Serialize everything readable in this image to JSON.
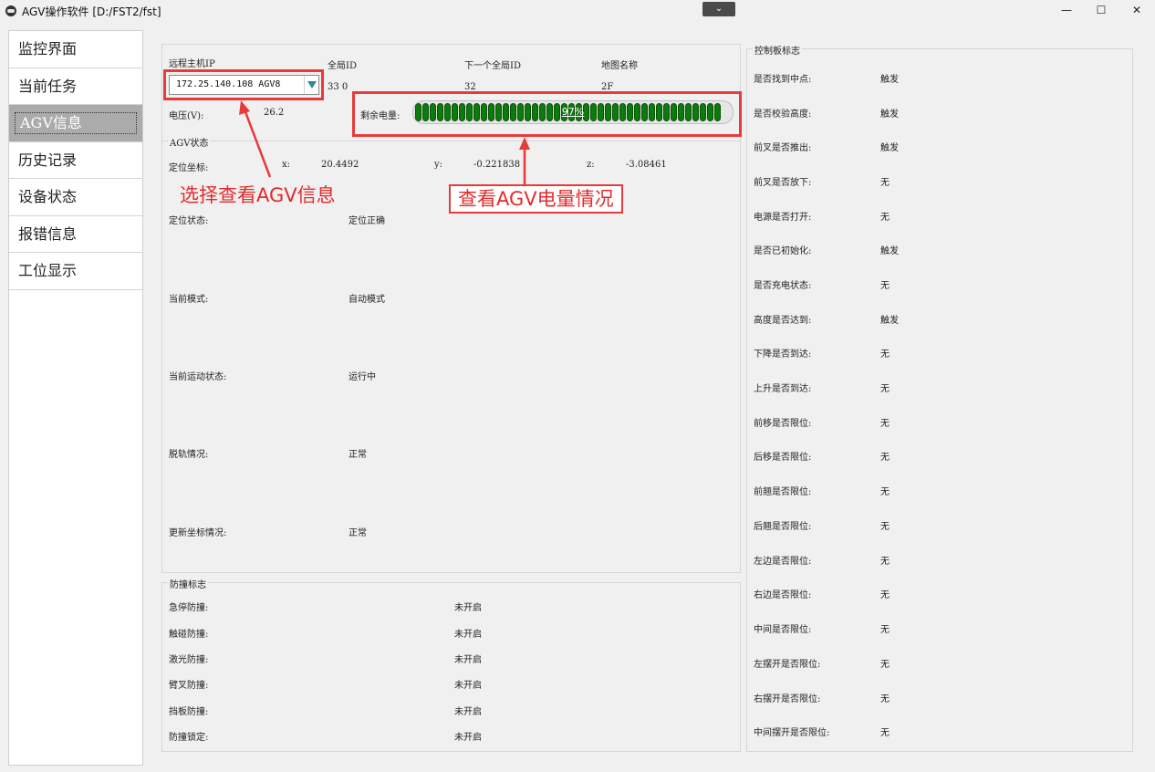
{
  "window": {
    "title": "AGV操作软件 [D:/FST2/fst]",
    "collapse_glyph": "⌄",
    "min_glyph": "—",
    "max_glyph": "☐",
    "close_glyph": "✕"
  },
  "sidebar": {
    "items": [
      {
        "label": "监控界面"
      },
      {
        "label": "当前任务"
      },
      {
        "label": "AGV信息"
      },
      {
        "label": "历史记录"
      },
      {
        "label": "设备状态"
      },
      {
        "label": "报错信息"
      },
      {
        "label": "工位显示"
      }
    ]
  },
  "header": {
    "remote_ip_label": "远程主机IP",
    "remote_ip_value": "172.25.140.108 AGV8",
    "global_id_label": "全局ID",
    "global_id_value": "33 0",
    "next_global_id_label": "下一个全局ID",
    "next_global_id_value": "32",
    "map_name_label": "地图名称",
    "map_name_value": "2F",
    "voltage_label": "电压(V):",
    "voltage_value": "26.2",
    "battery_label": "剩余电量:",
    "battery_text": "97%",
    "battery_level": 0.97
  },
  "agv_status": {
    "title": "AGV状态",
    "coord_label": "定位坐标:",
    "x_label": "x:",
    "x_value": "20.4492",
    "y_label": "y:",
    "y_value": "-0.221838",
    "z_label": "z:",
    "z_value": "-3.08461",
    "rows": [
      {
        "label": "定位状态:",
        "value": "定位正确"
      },
      {
        "label": "当前模式:",
        "value": "自动模式"
      },
      {
        "label": "当前运动状态:",
        "value": "运行中"
      },
      {
        "label": "脱轨情况:",
        "value": "正常"
      },
      {
        "label": "更新坐标情况:",
        "value": "正常"
      }
    ]
  },
  "collision": {
    "title": "防撞标志",
    "rows": [
      {
        "label": "急停防撞:",
        "value": "未开启"
      },
      {
        "label": "触碰防撞:",
        "value": "未开启"
      },
      {
        "label": "激光防撞:",
        "value": "未开启"
      },
      {
        "label": "臂叉防撞:",
        "value": "未开启"
      },
      {
        "label": "挡板防撞:",
        "value": "未开启"
      },
      {
        "label": "防撞锁定:",
        "value": "未开启"
      }
    ]
  },
  "control_flags": {
    "title": "控制板标志",
    "rows": [
      {
        "label": "是否找到中点:",
        "value": "触发"
      },
      {
        "label": "是否校验高度:",
        "value": "触发"
      },
      {
        "label": "前叉是否推出:",
        "value": "触发"
      },
      {
        "label": "前叉是否放下:",
        "value": "无"
      },
      {
        "label": "电源是否打开:",
        "value": "无"
      },
      {
        "label": "是否已初始化:",
        "value": "触发"
      },
      {
        "label": "是否充电状态:",
        "value": "无"
      },
      {
        "label": "高度是否达到:",
        "value": "触发"
      },
      {
        "label": "下降是否到达:",
        "value": "无"
      },
      {
        "label": "上升是否到达:",
        "value": "无"
      },
      {
        "label": "前移是否限位:",
        "value": "无"
      },
      {
        "label": "后移是否限位:",
        "value": "无"
      },
      {
        "label": "前翘是否限位:",
        "value": "无"
      },
      {
        "label": "后翘是否限位:",
        "value": "无"
      },
      {
        "label": "左边是否限位:",
        "value": "无"
      },
      {
        "label": "右边是否限位:",
        "value": "无"
      },
      {
        "label": "中间是否限位:",
        "value": "无"
      },
      {
        "label": "左摆开是否限位:",
        "value": "无"
      },
      {
        "label": "右摆开是否限位:",
        "value": "无"
      },
      {
        "label": "中间摆开是否限位:",
        "value": "无"
      }
    ]
  },
  "annotations": {
    "select_agv": "选择查看AGV信息",
    "battery_view": "查看AGV电量情况",
    "color": "#e83a3a"
  }
}
